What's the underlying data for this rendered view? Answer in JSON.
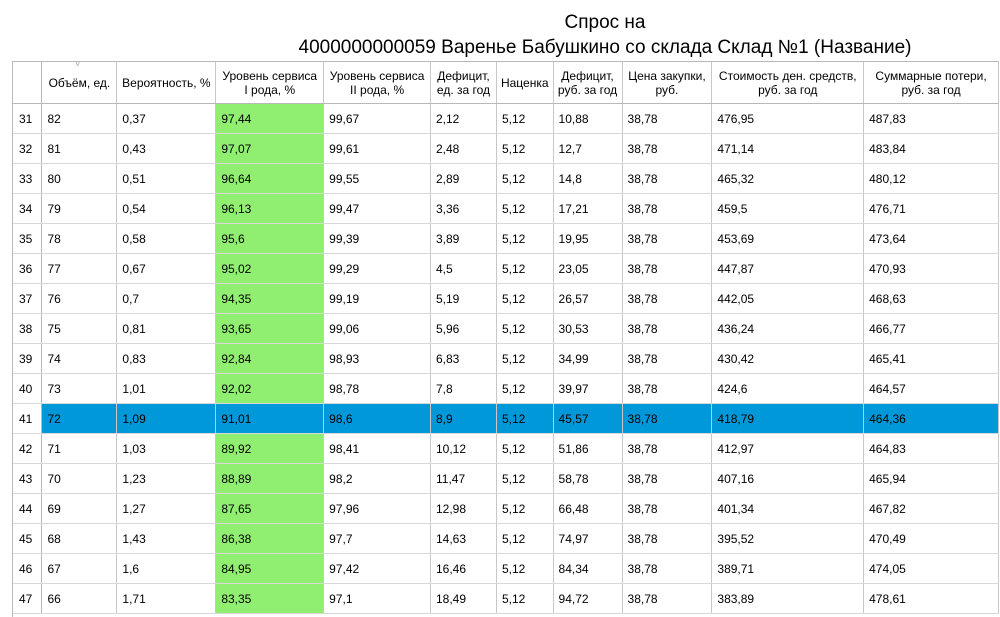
{
  "title": {
    "line1": "Спрос на",
    "line2": "4000000000059 Варенье Бабушкино со склада Склад №1 (Название)"
  },
  "colors": {
    "service_highlight": "#90ee70",
    "selected_row": "#0098d8"
  },
  "selected_row": "41",
  "columns": [
    "Объём, ед.",
    "Вероятность, %",
    "Уровень сервиса I рода, %",
    "Уровень сервиса II рода, %",
    "Дефицит, ед. за год",
    "Наценка",
    "Дефицит, руб. за год",
    "Цена закупки, руб.",
    "Стоимость ден. средств, руб. за год",
    "Суммарные потери, руб. за год"
  ],
  "rows": [
    {
      "n": "31",
      "cells": [
        "82",
        "0,37",
        "97,44",
        "99,67",
        "2,12",
        "5,12",
        "10,88",
        "38,78",
        "476,95",
        "487,83"
      ]
    },
    {
      "n": "32",
      "cells": [
        "81",
        "0,43",
        "97,07",
        "99,61",
        "2,48",
        "5,12",
        "12,7",
        "38,78",
        "471,14",
        "483,84"
      ]
    },
    {
      "n": "33",
      "cells": [
        "80",
        "0,51",
        "96,64",
        "99,55",
        "2,89",
        "5,12",
        "14,8",
        "38,78",
        "465,32",
        "480,12"
      ]
    },
    {
      "n": "34",
      "cells": [
        "79",
        "0,54",
        "96,13",
        "99,47",
        "3,36",
        "5,12",
        "17,21",
        "38,78",
        "459,5",
        "476,71"
      ]
    },
    {
      "n": "35",
      "cells": [
        "78",
        "0,58",
        "95,6",
        "99,39",
        "3,89",
        "5,12",
        "19,95",
        "38,78",
        "453,69",
        "473,64"
      ]
    },
    {
      "n": "36",
      "cells": [
        "77",
        "0,67",
        "95,02",
        "99,29",
        "4,5",
        "5,12",
        "23,05",
        "38,78",
        "447,87",
        "470,93"
      ]
    },
    {
      "n": "37",
      "cells": [
        "76",
        "0,7",
        "94,35",
        "99,19",
        "5,19",
        "5,12",
        "26,57",
        "38,78",
        "442,05",
        "468,63"
      ]
    },
    {
      "n": "38",
      "cells": [
        "75",
        "0,81",
        "93,65",
        "99,06",
        "5,96",
        "5,12",
        "30,53",
        "38,78",
        "436,24",
        "466,77"
      ]
    },
    {
      "n": "39",
      "cells": [
        "74",
        "0,83",
        "92,84",
        "98,93",
        "6,83",
        "5,12",
        "34,99",
        "38,78",
        "430,42",
        "465,41"
      ]
    },
    {
      "n": "40",
      "cells": [
        "73",
        "1,01",
        "92,02",
        "98,78",
        "7,8",
        "5,12",
        "39,97",
        "38,78",
        "424,6",
        "464,57"
      ]
    },
    {
      "n": "41",
      "cells": [
        "72",
        "1,09",
        "91,01",
        "98,6",
        "8,9",
        "5,12",
        "45,57",
        "38,78",
        "418,79",
        "464,36"
      ]
    },
    {
      "n": "42",
      "cells": [
        "71",
        "1,03",
        "89,92",
        "98,41",
        "10,12",
        "5,12",
        "51,86",
        "38,78",
        "412,97",
        "464,83"
      ]
    },
    {
      "n": "43",
      "cells": [
        "70",
        "1,23",
        "88,89",
        "98,2",
        "11,47",
        "5,12",
        "58,78",
        "38,78",
        "407,16",
        "465,94"
      ]
    },
    {
      "n": "44",
      "cells": [
        "69",
        "1,27",
        "87,65",
        "97,96",
        "12,98",
        "5,12",
        "66,48",
        "38,78",
        "401,34",
        "467,82"
      ]
    },
    {
      "n": "45",
      "cells": [
        "68",
        "1,43",
        "86,38",
        "97,7",
        "14,63",
        "5,12",
        "74,97",
        "38,78",
        "395,52",
        "470,49"
      ]
    },
    {
      "n": "46",
      "cells": [
        "67",
        "1,6",
        "84,95",
        "97,42",
        "16,46",
        "5,12",
        "84,34",
        "38,78",
        "389,71",
        "474,05"
      ]
    },
    {
      "n": "47",
      "cells": [
        "66",
        "1,71",
        "83,35",
        "97,1",
        "18,49",
        "5,12",
        "94,72",
        "38,78",
        "383,89",
        "478,61"
      ]
    }
  ]
}
